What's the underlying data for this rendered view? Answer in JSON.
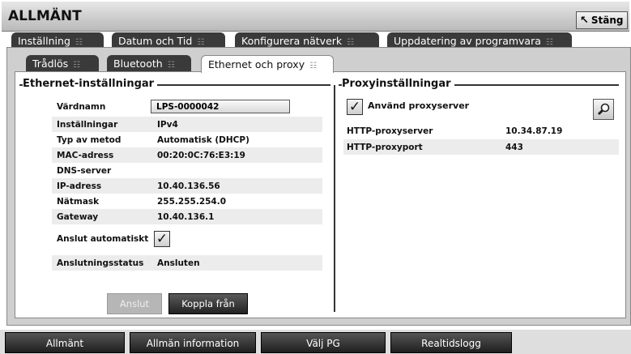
{
  "window": {
    "title": "ALLMÄNT",
    "close_label": "Stäng"
  },
  "top_tabs": [
    {
      "label": "Inställning",
      "active": false
    },
    {
      "label": "Datum och Tid",
      "active": false
    },
    {
      "label": "Konfigurera nätverk",
      "active": true
    },
    {
      "label": "Uppdatering av programvara",
      "active": false
    }
  ],
  "sub_tabs": [
    {
      "label": "Trådlös",
      "active": false
    },
    {
      "label": "Bluetooth",
      "active": false
    },
    {
      "label": "Ethernet och proxy",
      "active": true
    }
  ],
  "ethernet": {
    "title": "Ethernet-inställningar",
    "hostname": {
      "label": "Värdnamn",
      "value": "LPS-0000042"
    },
    "rows": [
      {
        "label": "Inställningar",
        "value": "IPv4"
      },
      {
        "label": "Typ av metod",
        "value": "Automatisk (DHCP)"
      },
      {
        "label": "MAC-adress",
        "value": "00:20:0C:76:E3:19"
      },
      {
        "label": "DNS-server",
        "value": ""
      },
      {
        "label": "IP-adress",
        "value": "10.40.136.56"
      },
      {
        "label": "Nätmask",
        "value": "255.255.254.0"
      },
      {
        "label": "Gateway",
        "value": "10.40.136.1"
      }
    ],
    "auto_connect": {
      "label": "Anslut automatiskt",
      "checked": true
    },
    "status": {
      "label": "Anslutningsstatus",
      "value": "Ansluten"
    },
    "connect_label": "Anslut",
    "disconnect_label": "Koppla från"
  },
  "proxy": {
    "title": "Proxyinställningar",
    "use_proxy": {
      "label": "Använd proxyserver",
      "checked": true
    },
    "rows": [
      {
        "label": "HTTP-proxyserver",
        "value": "10.34.87.19"
      },
      {
        "label": "HTTP-proxyport",
        "value": "443"
      }
    ]
  },
  "bottom_tabs": [
    {
      "label": "Allmänt"
    },
    {
      "label": "Allmän information"
    },
    {
      "label": "Välj PG"
    },
    {
      "label": "Realtidslogg"
    }
  ]
}
